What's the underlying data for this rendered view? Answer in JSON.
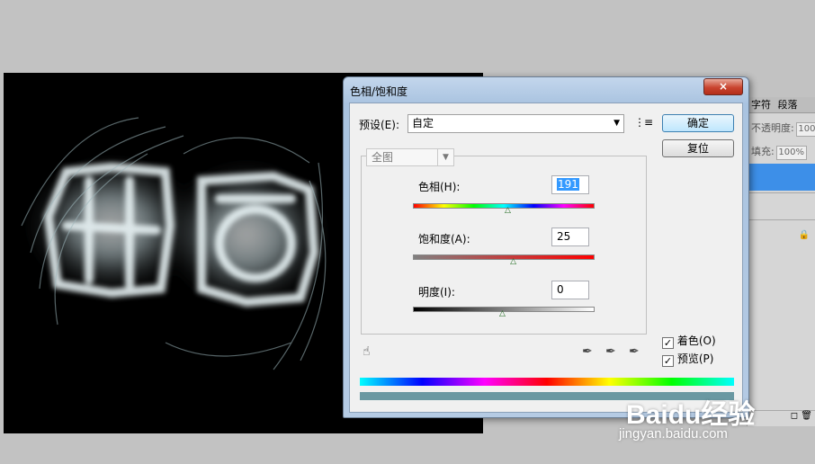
{
  "dialog": {
    "title": "色相/饱和度",
    "close_icon": "×",
    "preset_label": "预设(E):",
    "preset_value": "自定",
    "ok_label": "确定",
    "reset_label": "复位",
    "edit_value": "全图",
    "hue_label": "色相(H):",
    "hue_value": "191",
    "hue_level": 0.53,
    "saturation_label": "饱和度(A):",
    "saturation_value": "25",
    "saturation_level": 0.56,
    "lightness_label": "明度(I):",
    "lightness_value": "0",
    "lightness_level": 0.5,
    "colorize_label": "着色(O)",
    "colorize_checked": true,
    "preview_label": "预览(P)",
    "preview_checked": true
  },
  "layers_panel": {
    "tabs": [
      "字符",
      "段落"
    ],
    "opacity_label": "不透明度:",
    "opacity_value": "100%",
    "fill_label": "填充:",
    "fill_value": "100%"
  },
  "watermark": {
    "logo": "Baidu经验",
    "url": "jingyan.baidu.com"
  },
  "colors": {
    "tint": "#6a98a2",
    "titlebar": "#b5cbe4",
    "selection": "#3399ff"
  }
}
